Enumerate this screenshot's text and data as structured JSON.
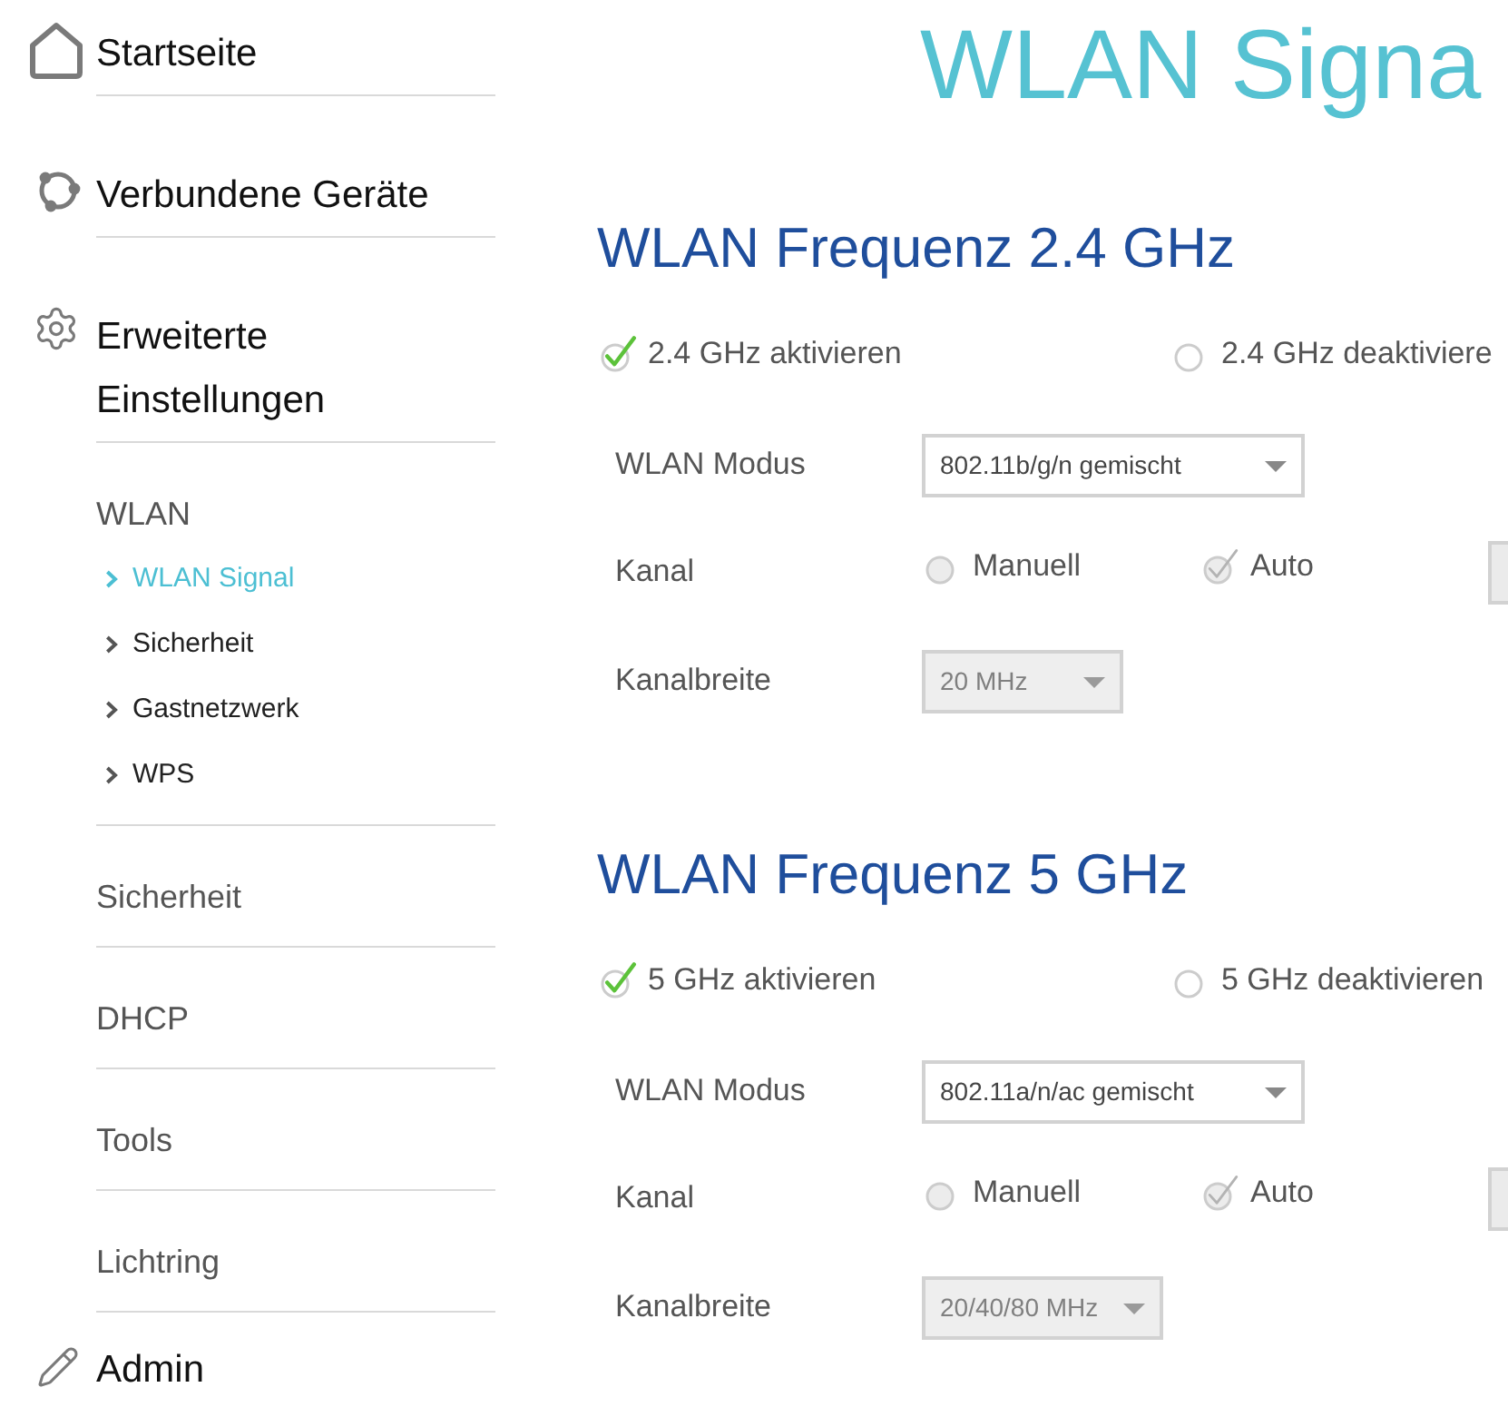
{
  "sidebar": {
    "items": [
      {
        "label": "Startseite"
      },
      {
        "label": "Verbundene Geräte"
      },
      {
        "label": "Erweiterte Einstellungen",
        "children": [
          {
            "label": "WLAN",
            "children": [
              {
                "label": "WLAN Signal",
                "selected": true
              },
              {
                "label": "Sicherheit",
                "selected": false
              },
              {
                "label": "Gastnetzwerk",
                "selected": false
              },
              {
                "label": "WPS",
                "selected": false
              }
            ]
          },
          {
            "label": "Sicherheit"
          },
          {
            "label": "DHCP"
          },
          {
            "label": "Tools"
          },
          {
            "label": "Lichtring"
          }
        ]
      },
      {
        "label": "Admin"
      }
    ]
  },
  "page_title": "WLAN Signa",
  "sections": [
    {
      "heading": "WLAN Frequenz 2.4 GHz",
      "band_options": [
        {
          "label": "2.4 GHz aktivieren",
          "selected": true,
          "disabled": false
        },
        {
          "label": "2.4 GHz deaktiviere",
          "selected": false,
          "disabled": false
        }
      ],
      "fields": [
        {
          "kind": "select",
          "label": "WLAN Modus",
          "value": "802.11b/g/n gemischt",
          "disabled": false
        },
        {
          "kind": "radio",
          "label": "Kanal",
          "options": [
            {
              "label": "Manuell",
              "selected": false,
              "disabled": true
            },
            {
              "label": "Auto",
              "selected": true,
              "disabled": true
            }
          ],
          "channel_field": {
            "disabled": true
          }
        },
        {
          "kind": "select",
          "label": "Kanalbreite",
          "value": "20 MHz",
          "disabled": true
        }
      ]
    },
    {
      "heading": "WLAN Frequenz 5 GHz",
      "band_options": [
        {
          "label": "5 GHz aktivieren",
          "selected": true,
          "disabled": false
        },
        {
          "label": "5 GHz deaktivieren",
          "selected": false,
          "disabled": false
        }
      ],
      "fields": [
        {
          "kind": "select",
          "label": "WLAN Modus",
          "value": "802.11a/n/ac gemischt",
          "disabled": false
        },
        {
          "kind": "radio",
          "label": "Kanal",
          "options": [
            {
              "label": "Manuell",
              "selected": false,
              "disabled": true
            },
            {
              "label": "Auto",
              "selected": true,
              "disabled": true
            }
          ],
          "channel_field": {
            "disabled": true
          }
        },
        {
          "kind": "select",
          "label": "Kanalbreite",
          "value": "20/40/80 MHz",
          "disabled": true
        }
      ]
    }
  ]
}
